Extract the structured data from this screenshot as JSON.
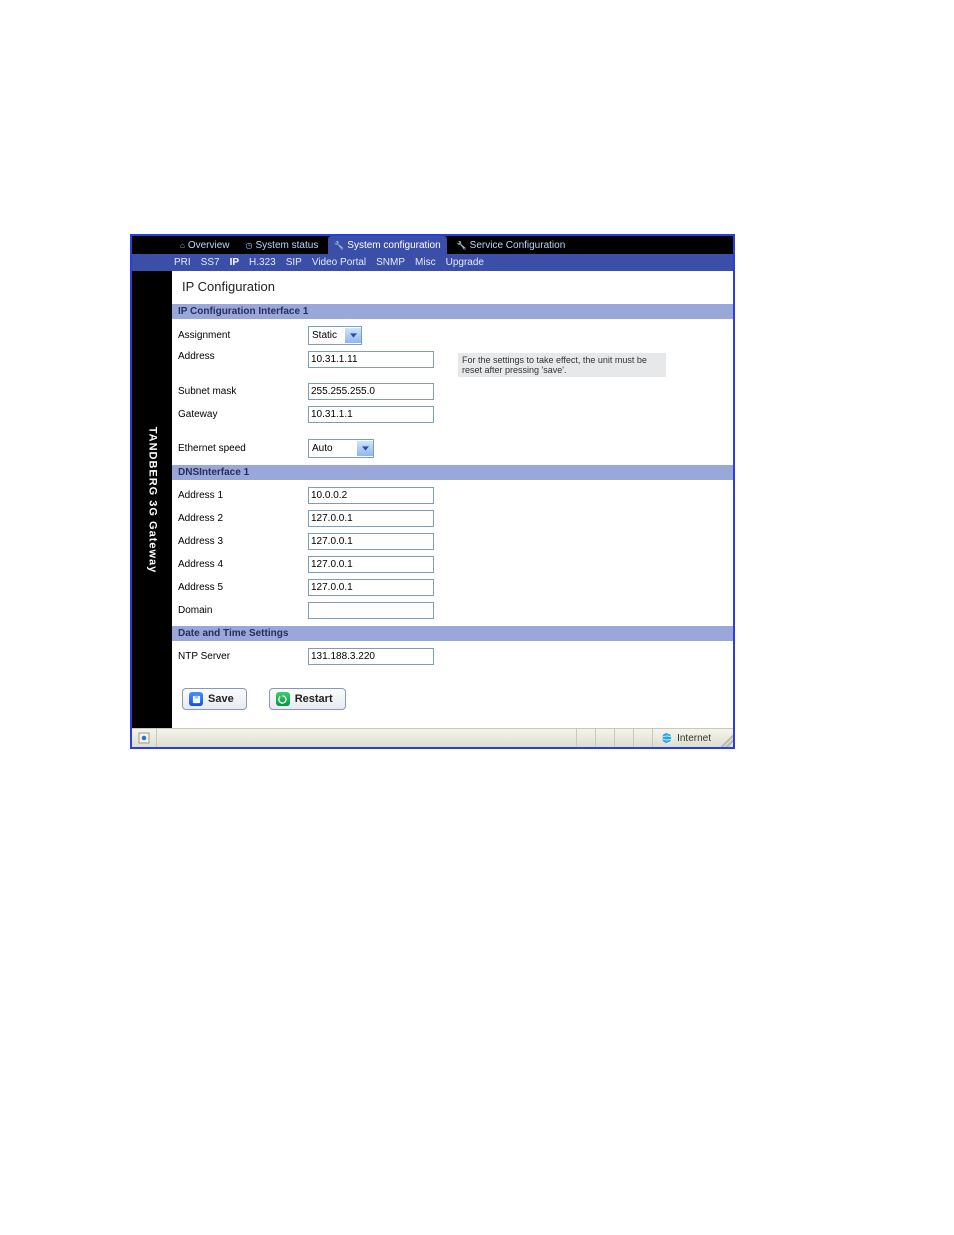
{
  "brand": "TANDBERG 3G Gateway",
  "top_tabs": [
    {
      "label": "Overview"
    },
    {
      "label": "System status"
    },
    {
      "label": "System configuration"
    },
    {
      "label": "Service Configuration"
    }
  ],
  "top_tab_active_index": 2,
  "sub_tabs": [
    "PRI",
    "SS7",
    "IP",
    "H.323",
    "SIP",
    "Video Portal",
    "SNMP",
    "Misc",
    "Upgrade"
  ],
  "sub_tab_active_index": 2,
  "page_title": "IP Configuration",
  "sections": {
    "ipif": {
      "header": "IP Configuration Interface 1",
      "assignment_label": "Assignment",
      "assignment_value": "Static",
      "address_label": "Address",
      "address_value": "10.31.1.11",
      "address_note": "For the settings to take effect, the unit must be reset after pressing 'save'.",
      "subnet_label": "Subnet mask",
      "subnet_value": "255.255.255.0",
      "gateway_label": "Gateway",
      "gateway_value": "10.31.1.1",
      "ethspeed_label": "Ethernet speed",
      "ethspeed_value": "Auto"
    },
    "dns": {
      "header": "DNSInterface 1",
      "addr1_label": "Address 1",
      "addr1_value": "10.0.0.2",
      "addr2_label": "Address 2",
      "addr2_value": "127.0.0.1",
      "addr3_label": "Address 3",
      "addr3_value": "127.0.0.1",
      "addr4_label": "Address 4",
      "addr4_value": "127.0.0.1",
      "addr5_label": "Address 5",
      "addr5_value": "127.0.0.1",
      "domain_label": "Domain",
      "domain_value": ""
    },
    "dt": {
      "header": "Date and Time Settings",
      "ntp_label": "NTP Server",
      "ntp_value": "131.188.3.220"
    }
  },
  "buttons": {
    "save": "Save",
    "restart": "Restart"
  },
  "statusbar": {
    "zone": "Internet"
  }
}
